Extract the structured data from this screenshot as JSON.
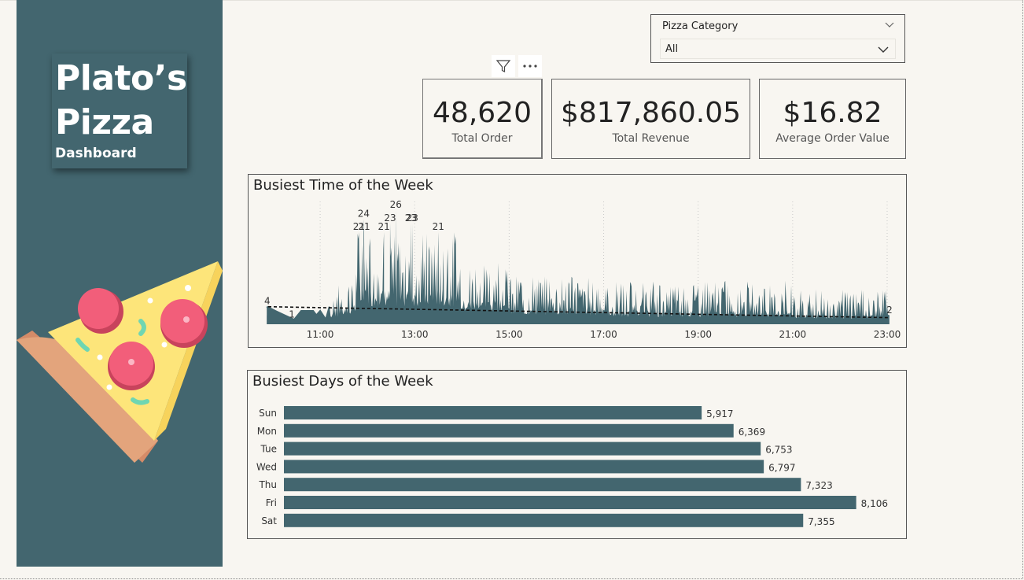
{
  "branding": {
    "title_line1": "Plato’s",
    "title_line2": "Pizza",
    "subtitle": "Dashboard"
  },
  "colors": {
    "primary": "#43666f",
    "background": "#f8f6f1",
    "area_fill": "#9fb2b6",
    "pizza_crust": "#e3a47c",
    "pizza_cheese": "#fde57a",
    "pepperoni": "#f25e7a"
  },
  "slicer": {
    "title": "Pizza Category",
    "selected": "All",
    "header_icon": "chevron-down-icon",
    "dropdown_icon": "chevron-down-icon"
  },
  "visual_header": {
    "filter_icon": "filter-icon",
    "more_icon": "more-options-icon"
  },
  "kpis": [
    {
      "value": "48,620",
      "label": "Total Order"
    },
    {
      "value": "$817,860.05",
      "label": "Total Revenue"
    },
    {
      "value": "$16.82",
      "label": "Average Order Value"
    }
  ],
  "chart_data": [
    {
      "type": "area",
      "title": "Busiest Time of the Week",
      "x_tick_labels": [
        "11:00",
        "13:00",
        "15:00",
        "17:00",
        "19:00",
        "21:00",
        "23:00"
      ],
      "x_range_hours": [
        9.85,
        23.1
      ],
      "y_range": [
        0,
        28
      ],
      "grid": "vertical dotted",
      "trend_line": {
        "style": "dashed",
        "start": 4,
        "end": 1.5
      },
      "data_labels": [
        {
          "x": 9.88,
          "y": 4,
          "label": "4"
        },
        {
          "x": 10.4,
          "y": 1,
          "label": "1"
        },
        {
          "x": 11.82,
          "y": 21,
          "label": "21"
        },
        {
          "x": 11.92,
          "y": 24,
          "label": "24"
        },
        {
          "x": 11.93,
          "y": 21,
          "label": "21"
        },
        {
          "x": 12.35,
          "y": 21,
          "label": "21"
        },
        {
          "x": 12.48,
          "y": 23,
          "label": "23"
        },
        {
          "x": 12.6,
          "y": 26,
          "label": "26"
        },
        {
          "x": 12.92,
          "y": 23,
          "label": "23"
        },
        {
          "x": 12.95,
          "y": 23,
          "label": "23"
        },
        {
          "x": 13.5,
          "y": 21,
          "label": "21"
        },
        {
          "x": 23.05,
          "y": 2,
          "label": "2"
        }
      ],
      "series": [
        {
          "name": "",
          "style": "line-area",
          "values_note": ""
        }
      ]
    },
    {
      "type": "bar",
      "orientation": "horizontal",
      "title": "Busiest Days of the Week",
      "categories": [
        "Sun",
        "Mon",
        "Tue",
        "Wed",
        "Thu",
        "Fri",
        "Sat"
      ],
      "values": [
        5917,
        6369,
        6753,
        6797,
        7323,
        8106,
        7355
      ],
      "value_labels": [
        "5,917",
        "6,369",
        "6,753",
        "6,797",
        "7,323",
        "8,106",
        "7,355"
      ],
      "xlim": [
        0,
        8600
      ]
    }
  ]
}
